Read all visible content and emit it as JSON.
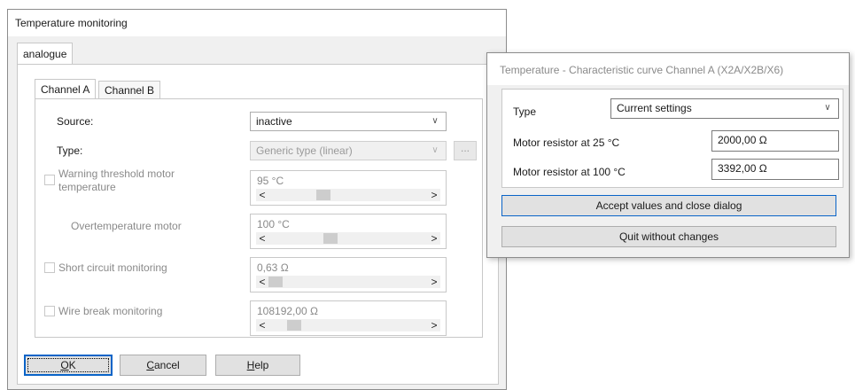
{
  "main_dialog": {
    "title": "Temperature monitoring",
    "outer_tab": "analogue",
    "channel_tabs": [
      "Channel A",
      "Channel B"
    ],
    "source": {
      "label": "Source:",
      "value": "inactive"
    },
    "type": {
      "label": "Type:",
      "value": "Generic type (linear)",
      "more_button": "..."
    },
    "warning_threshold": {
      "label_line1": "Warning threshold motor",
      "label_line2": "temperature",
      "checked": false,
      "value": "95 °C",
      "slider_fraction": 0.33
    },
    "overtemperature": {
      "label": "Overtemperature motor",
      "value": "100 °C",
      "slider_fraction": 0.38
    },
    "short_circuit": {
      "label": "Short circuit monitoring",
      "checked": false,
      "value": "0,63 Ω",
      "slider_fraction": 0.0
    },
    "wire_break": {
      "label": "Wire break monitoring",
      "checked": false,
      "value": "108192,00 Ω",
      "slider_fraction": 0.13
    },
    "scroll_left": "<",
    "scroll_right": ">",
    "buttons": {
      "ok_prefix": "O",
      "ok_rest": "K",
      "cancel_prefix": "C",
      "cancel_rest": "ancel",
      "help_prefix": "H",
      "help_rest": "elp"
    }
  },
  "curve_dialog": {
    "title": "Temperature - Characteristic curve Channel A (X2A/X2B/X6)",
    "type": {
      "label": "Type",
      "value": "Current settings"
    },
    "r25": {
      "label": "Motor resistor at 25  °C",
      "value": "2000,00 Ω"
    },
    "r100": {
      "label": "Motor resistor at 100  °C",
      "value": "3392,00 Ω"
    },
    "accept_button": "Accept values and close dialog",
    "quit_button": "Quit without changes"
  },
  "colors": {
    "accent": "#0a64c8",
    "dialog_bg": "#f0f0f0",
    "disabled_text": "#8a8a8a"
  }
}
